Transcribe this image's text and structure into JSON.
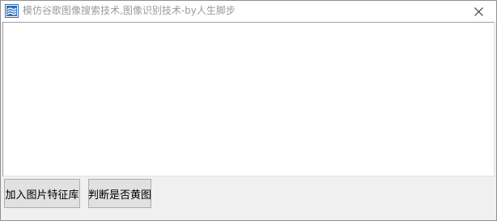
{
  "window": {
    "title": "模仿谷歌图像搜索技术,图像识别技术-by人生脚步",
    "app_icon": "app-icon",
    "close_icon": "close-icon"
  },
  "buttons": {
    "add_feature_label": "加入图片特征库",
    "judge_label": "判断是否黄图"
  },
  "colors": {
    "title_text": "#9a9a9a",
    "icon_blue": "#2f6fb3",
    "button_bg": "#e1e1e1",
    "window_bg": "#f0f0f0"
  }
}
